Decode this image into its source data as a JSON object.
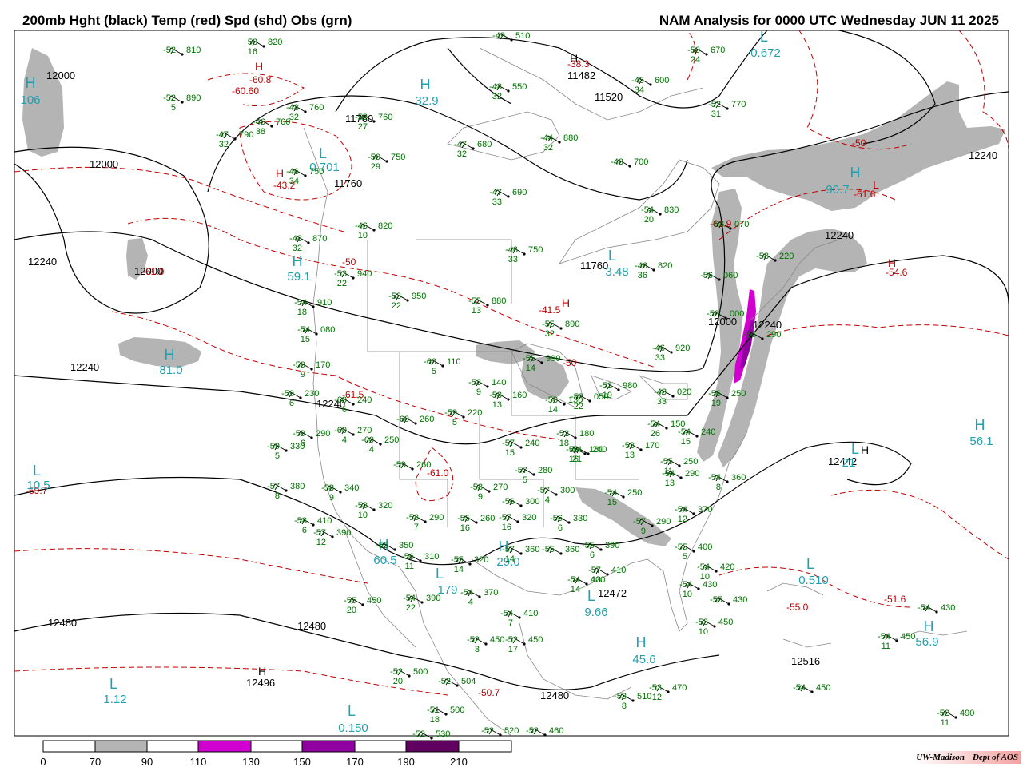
{
  "title_left": "200mb Hght (black) Temp (red) Spd (shd) Obs (grn)",
  "title_right": "NAM Analysis for 0000 UTC Wednesday  JUN 11 2025",
  "credit": {
    "org": "UW-Madison",
    "dept": "Dept of AOS"
  },
  "colors": {
    "height": "#000000",
    "temp": "#c00000",
    "obs": "#007000",
    "center": "#20a0b0",
    "shade70": "#b4b4b4",
    "shade110": "#d000d0",
    "shade150": "#9000a0",
    "shade190": "#600060"
  },
  "colorbar": {
    "ticks": [
      "0",
      "70",
      "90",
      "110",
      "130",
      "150",
      "170",
      "190",
      "210"
    ]
  },
  "height_labels": [
    "12000",
    "12000",
    "12000",
    "12240",
    "12240",
    "12480",
    "12480",
    "12496",
    "12480",
    "11760",
    "11760",
    "11760",
    "11482",
    "11520",
    "12240",
    "12000",
    "12240",
    "12240",
    "12240",
    "12442",
    "12472",
    "12516"
  ],
  "temp_labels": [
    "-60.8",
    "-60.60",
    "-43.2",
    "-38.3",
    "-50",
    "-41.5",
    "-50",
    "-61.0",
    "-61.5",
    "-61.0",
    "-59.7",
    "-55.0",
    "-51.6",
    "-50.7",
    "-54.6",
    "-61.6",
    "-50",
    "-61.9"
  ],
  "centers": [
    {
      "letter": "H",
      "value": "106",
      "color": "center"
    },
    {
      "letter": "H",
      "value": "32.9",
      "color": "center"
    },
    {
      "letter": "L",
      "value": "0.672",
      "color": "center"
    },
    {
      "letter": "L",
      "value": "0.701",
      "color": "center"
    },
    {
      "letter": "H",
      "value": "59.1",
      "color": "center"
    },
    {
      "letter": "H",
      "value": "81.0",
      "color": "center"
    },
    {
      "letter": "L",
      "value": "3.48",
      "color": "center"
    },
    {
      "letter": "H",
      "value": "56.1",
      "color": "center"
    },
    {
      "letter": "L",
      "value": "10.5",
      "color": "center"
    },
    {
      "letter": "H",
      "value": "60.5",
      "color": "center"
    },
    {
      "letter": "L",
      "value": "179",
      "color": "center"
    },
    {
      "letter": "H",
      "value": "29.0",
      "color": "center"
    },
    {
      "letter": "L",
      "value": "9.66",
      "color": "center"
    },
    {
      "letter": "H",
      "value": "45.6",
      "color": "center"
    },
    {
      "letter": "L",
      "value": "0.510",
      "color": "center"
    },
    {
      "letter": "L",
      "value": "1.12",
      "color": "center"
    },
    {
      "letter": "L",
      "value": "0.150",
      "color": "center"
    },
    {
      "letter": "H",
      "value": "56.9",
      "color": "center"
    },
    {
      "letter": "H",
      "value": "90.7",
      "color": "center"
    },
    {
      "letter": "L",
      "value": "21",
      "color": "center"
    },
    {
      "letter": "H",
      "value": "",
      "color": "black"
    },
    {
      "letter": "H",
      "value": "",
      "color": "black"
    },
    {
      "letter": "H",
      "value": "",
      "color": "black"
    },
    {
      "letter": "H",
      "value": "",
      "color": "temp"
    },
    {
      "letter": "H",
      "value": "",
      "color": "temp"
    },
    {
      "letter": "H",
      "value": "",
      "color": "temp"
    },
    {
      "letter": "L",
      "value": "",
      "color": "temp"
    },
    {
      "letter": "H",
      "value": "",
      "color": "temp"
    }
  ],
  "stations": [
    {
      "t": "-52",
      "h": "810",
      "s": ""
    },
    {
      "t": "58",
      "h": "820",
      "s": "16"
    },
    {
      "t": "-52",
      "h": "890",
      "s": "5"
    },
    {
      "t": "-48",
      "h": "760",
      "s": "32"
    },
    {
      "t": "-46",
      "h": "760",
      "s": "38"
    },
    {
      "t": "-47",
      "h": "790",
      "s": "32"
    },
    {
      "t": "-52",
      "h": "760",
      "s": "27"
    },
    {
      "t": "-49",
      "h": "510",
      "s": ""
    },
    {
      "t": "-48",
      "h": "550",
      "s": "32"
    },
    {
      "t": "-47",
      "h": "680",
      "s": "32"
    },
    {
      "t": "-44",
      "h": "880",
      "s": "32"
    },
    {
      "t": "-45",
      "h": "600",
      "s": "34"
    },
    {
      "t": "-52",
      "h": "770",
      "s": "31"
    },
    {
      "t": "-50",
      "h": "670",
      "s": "24"
    },
    {
      "t": "-50",
      "h": "750",
      "s": "29"
    },
    {
      "t": "-46",
      "h": "750",
      "s": "34"
    },
    {
      "t": "-48",
      "h": "700",
      "s": ""
    },
    {
      "t": "-47",
      "h": "690",
      "s": "33"
    },
    {
      "t": "-46",
      "h": "820",
      "s": "10"
    },
    {
      "t": "-46",
      "h": "750",
      "s": "33"
    },
    {
      "t": "-54",
      "h": "830",
      "s": "20"
    },
    {
      "t": "-58",
      "h": "070",
      "s": ""
    },
    {
      "t": "-46",
      "h": "820",
      "s": "36"
    },
    {
      "t": "-56",
      "h": "060",
      "s": ""
    },
    {
      "t": "-58",
      "h": "220",
      "s": ""
    },
    {
      "t": "-48",
      "h": "870",
      "s": "32"
    },
    {
      "t": "-53",
      "h": "940",
      "s": "22"
    },
    {
      "t": "-53",
      "h": "950",
      "s": "22"
    },
    {
      "t": "-54",
      "h": "910",
      "s": "18"
    },
    {
      "t": "-55",
      "h": "880",
      "s": "13"
    },
    {
      "t": "-55",
      "h": "890",
      "s": "32"
    },
    {
      "t": "-54",
      "h": "080",
      "s": "15"
    },
    {
      "t": "-55",
      "h": "990",
      "s": "14"
    },
    {
      "t": "-46",
      "h": "920",
      "s": "33"
    },
    {
      "t": "-58",
      "h": "000",
      "s": ""
    },
    {
      "t": "-56",
      "h": "290",
      "s": ""
    },
    {
      "t": "-59",
      "h": "170",
      "s": "9"
    },
    {
      "t": "-60",
      "h": "110",
      "s": "5"
    },
    {
      "t": "-58",
      "h": "140",
      "s": "9"
    },
    {
      "t": "-59",
      "h": "230",
      "s": "6"
    },
    {
      "t": "-60",
      "h": "240",
      "s": "6"
    },
    {
      "t": "-59",
      "h": "220",
      "s": "5"
    },
    {
      "t": "-58",
      "h": "160",
      "s": "13"
    },
    {
      "t": "-56",
      "h": "130",
      "s": "14"
    },
    {
      "t": "-52",
      "h": "050",
      "s": "22"
    },
    {
      "t": "-52",
      "h": "980",
      "s": "19"
    },
    {
      "t": "-48",
      "h": "020",
      "s": "33"
    },
    {
      "t": "-52",
      "h": "180",
      "s": "18"
    },
    {
      "t": "-56",
      "h": "250",
      "s": "19"
    },
    {
      "t": "-60",
      "h": "260",
      "s": ""
    },
    {
      "t": "-60",
      "h": "270",
      "s": "4"
    },
    {
      "t": "-60",
      "h": "250",
      "s": "4"
    },
    {
      "t": "-59",
      "h": "290",
      "s": "6"
    },
    {
      "t": "-59",
      "h": "330",
      "s": "5"
    },
    {
      "t": "-59",
      "h": "260",
      "s": ""
    },
    {
      "t": "-57",
      "h": "240",
      "s": "15"
    },
    {
      "t": "-56",
      "h": "180",
      "s": "16"
    },
    {
      "t": "-54",
      "h": "200",
      "s": "21"
    },
    {
      "t": "-53",
      "h": "170",
      "s": "13"
    },
    {
      "t": "-54",
      "h": "150",
      "s": "26"
    },
    {
      "t": "-54",
      "h": "240",
      "s": "15"
    },
    {
      "t": "-55",
      "h": "250",
      "s": "11"
    },
    {
      "t": "-57",
      "h": "380",
      "s": "8"
    },
    {
      "t": "-58",
      "h": "340",
      "s": "9"
    },
    {
      "t": "-58",
      "h": "320",
      "s": "10"
    },
    {
      "t": "-57",
      "h": "280",
      "s": "5"
    },
    {
      "t": "-58",
      "h": "270",
      "s": "9"
    },
    {
      "t": "-57",
      "h": "300",
      "s": "4"
    },
    {
      "t": "-54",
      "h": "250",
      "s": "15"
    },
    {
      "t": "-54",
      "h": "290",
      "s": "13"
    },
    {
      "t": "-54",
      "h": "360",
      "s": "8"
    },
    {
      "t": "-56",
      "h": "300",
      "s": ""
    },
    {
      "t": "-58",
      "h": "410",
      "s": "6"
    },
    {
      "t": "-57",
      "h": "390",
      "s": "12"
    },
    {
      "t": "-58",
      "h": "290",
      "s": "7"
    },
    {
      "t": "-55",
      "h": "260",
      "s": "16"
    },
    {
      "t": "-57",
      "h": "320",
      "s": "16"
    },
    {
      "t": "-56",
      "h": "330",
      "s": "6"
    },
    {
      "t": "-57",
      "h": "290",
      "s": "9"
    },
    {
      "t": "-55",
      "h": "350",
      "s": ""
    },
    {
      "t": "-54",
      "h": "370",
      "s": "12"
    },
    {
      "t": "-56",
      "h": "310",
      "s": "11"
    },
    {
      "t": "-55",
      "h": "320",
      "s": "14"
    },
    {
      "t": "-57",
      "h": "360",
      "s": "14"
    },
    {
      "t": "-55",
      "h": "360",
      "s": ""
    },
    {
      "t": "-55",
      "h": "390",
      "s": "6"
    },
    {
      "t": "-55",
      "h": "400",
      "s": "5"
    },
    {
      "t": "-54",
      "h": "400",
      "s": "14"
    },
    {
      "t": "-57",
      "h": "410",
      "s": "13"
    },
    {
      "t": "-54",
      "h": "420",
      "s": "10"
    },
    {
      "t": "-54",
      "h": "430",
      "s": "10"
    },
    {
      "t": "-55",
      "h": "430",
      "s": ""
    },
    {
      "t": "-53",
      "h": "450",
      "s": "10"
    },
    {
      "t": "-55",
      "h": "450",
      "s": "20"
    },
    {
      "t": "-54",
      "h": "390",
      "s": "22"
    },
    {
      "t": "-54",
      "h": "370",
      "s": "4"
    },
    {
      "t": "-54",
      "h": "410",
      "s": "7"
    },
    {
      "t": "-52",
      "h": "450",
      "s": "3"
    },
    {
      "t": "-52",
      "h": "450",
      "s": "17"
    },
    {
      "t": "-52",
      "h": "500",
      "s": "20"
    },
    {
      "t": "-52",
      "h": "504",
      "s": ""
    },
    {
      "t": "-51",
      "h": "500",
      "s": "18"
    },
    {
      "t": "-52",
      "h": "530",
      "s": ""
    },
    {
      "t": "-52",
      "h": "520",
      "s": ""
    },
    {
      "t": "-52",
      "h": "460",
      "s": ""
    },
    {
      "t": "-53",
      "h": "510",
      "s": "8"
    },
    {
      "t": "-53",
      "h": "470",
      "s": "12"
    },
    {
      "t": "-54",
      "h": "450",
      "s": ""
    },
    {
      "t": "-54",
      "h": "430",
      "s": ""
    },
    {
      "t": "-54",
      "h": "450",
      "s": "11"
    },
    {
      "t": "-52",
      "h": "490",
      "s": "11"
    }
  ]
}
